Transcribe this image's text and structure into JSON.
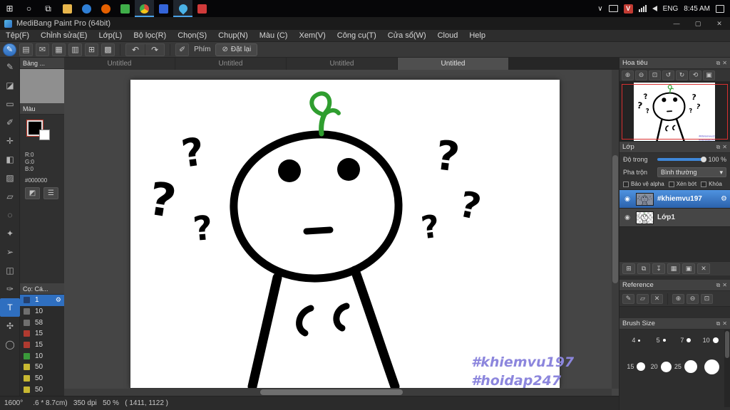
{
  "taskbar": {
    "time": "8:45 AM",
    "lang": "ENG",
    "unikey": "V"
  },
  "window": {
    "title": "MediBang Paint Pro (64bit)"
  },
  "menubar": {
    "items": [
      "Tệp(F)",
      "Chỉnh sửa(E)",
      "Lớp(L)",
      "Bộ lọc(R)",
      "Chọn(S)",
      "Chụp(N)",
      "Màu (C)",
      "Xem(V)",
      "Công cụ(T)",
      "Cửa sổ(W)",
      "Cloud",
      "Help"
    ]
  },
  "toolbar": {
    "phim": "Phím",
    "reset": "Đặt lại"
  },
  "tabs": [
    {
      "label": "Untitled"
    },
    {
      "label": "Untitled"
    },
    {
      "label": "Untitled"
    },
    {
      "label": "Untitled"
    }
  ],
  "tools": {
    "items": [
      {
        "name": "pen",
        "glyph": "✎"
      },
      {
        "name": "eraser",
        "glyph": "◪"
      },
      {
        "name": "select",
        "glyph": "▭"
      },
      {
        "name": "brush",
        "glyph": "✐"
      },
      {
        "name": "move",
        "glyph": "✛"
      },
      {
        "name": "fill",
        "glyph": "◧"
      },
      {
        "name": "gradient",
        "glyph": "▨"
      },
      {
        "name": "shape",
        "glyph": "▱"
      },
      {
        "name": "lasso",
        "glyph": "◌"
      },
      {
        "name": "magic-wand",
        "glyph": "✦"
      },
      {
        "name": "control",
        "glyph": "➢"
      },
      {
        "name": "divide",
        "glyph": "◫"
      },
      {
        "name": "eyedropper",
        "glyph": "✑"
      },
      {
        "name": "text",
        "glyph": "T"
      },
      {
        "name": "hand",
        "glyph": "✣"
      },
      {
        "name": "zoom",
        "glyph": "◯"
      }
    ]
  },
  "left_panels": {
    "palette_title": "Bảng ...",
    "color_title": "Màu",
    "r": "R:0",
    "g": "G:0",
    "b": "B:0",
    "hex": "#000000",
    "brush_title": "Cọ: Cá...",
    "brushes": [
      {
        "size": "1",
        "color": "#24406e"
      },
      {
        "size": "10",
        "color": "#6f6f6f"
      },
      {
        "size": "58",
        "color": "#6f6f6f"
      },
      {
        "size": "15",
        "color": "#b03a30"
      },
      {
        "size": "15",
        "color": "#b03a30"
      },
      {
        "size": "10",
        "color": "#3a9a3a"
      },
      {
        "size": "50",
        "color": "#c8b832"
      },
      {
        "size": "50",
        "color": "#c8b832"
      },
      {
        "size": "50",
        "color": "#c8b832"
      }
    ]
  },
  "canvas": {
    "qmark": "?",
    "tag1": "#khiemvu197",
    "tag2": "#hoidap247"
  },
  "status": {
    "zoom": "1600°",
    "info": ".6 * 8.7cm)   350 dpi   50 %   ( 1411, 1122 )"
  },
  "navigator": {
    "title": "Hoa tiêu"
  },
  "layer_panel": {
    "title": "Lớp",
    "opacity_label": "Độ trong",
    "opacity_value": "100 %",
    "blend_label": "Pha trộn",
    "blend_value": "Bình thường",
    "check1": "Bảo vệ alpha",
    "check2": "Xén bớt",
    "check3": "Khóa",
    "layers": [
      {
        "name": "#khiemvu197"
      },
      {
        "name": "Lớp1"
      }
    ]
  },
  "reference": {
    "title": "Reference"
  },
  "brush_size": {
    "title": "Brush Size",
    "items": [
      {
        "label": "4"
      },
      {
        "label": "5"
      },
      {
        "label": "7"
      },
      {
        "label": "10"
      },
      {
        "label": "15"
      },
      {
        "label": "20"
      },
      {
        "label": "25"
      },
      {
        "label": ""
      }
    ]
  },
  "colors": {
    "accent": "#3f87d8",
    "selection": "#2f6fc0",
    "canvas_tag": "#8c86dd",
    "sprout": "#2f9e2f"
  },
  "icons": {
    "start": "⊞",
    "search": "○",
    "task_view": "⧉",
    "tray_chevron": "∨",
    "minimize": "—",
    "maximize": "▢",
    "close": "✕",
    "brush": "✎",
    "save": "▤",
    "chat": "✉",
    "image": "▦",
    "pages": "▥",
    "grid": "⊞",
    "material": "▩",
    "undo": "↶",
    "redo": "↷",
    "pen": "✐",
    "slash": "⊘",
    "dropdown": "▾",
    "float": "⧉",
    "panel_close": "✕",
    "gear": "⚙",
    "eye": "◉",
    "nav_tools": [
      "⊕",
      "⊖",
      "⊡",
      "↺",
      "↻",
      "⟲",
      "▣"
    ],
    "layer_tools": [
      "⊞",
      "⧉",
      "↧",
      "▦",
      "▣",
      "✕"
    ],
    "ref_tools": [
      "✎",
      "▱",
      "✕",
      "⊕",
      "⊖",
      "⊡"
    ],
    "color_tools": [
      "◩",
      "☰"
    ]
  }
}
